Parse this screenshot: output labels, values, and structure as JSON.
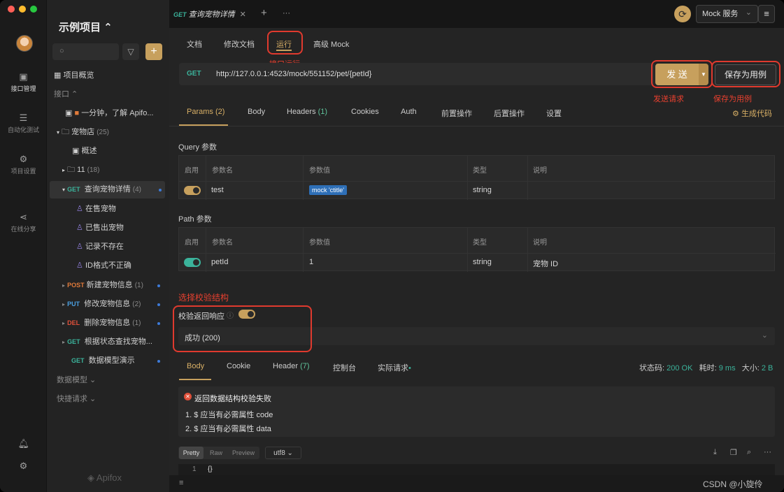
{
  "window": {
    "traffic": [
      "#ff5f57",
      "#febc2e",
      "#28c840"
    ]
  },
  "rail": {
    "items": [
      {
        "label": "接口管理",
        "icon": "api-icon"
      },
      {
        "label": "自动化测试",
        "icon": "test-icon"
      },
      {
        "label": "项目设置",
        "icon": "settings-icon"
      },
      {
        "label": "在线分享",
        "icon": "share-icon"
      }
    ]
  },
  "sidebar": {
    "project": "示例项目 ⌃",
    "overview": "项目概览",
    "api_header": "接口 ⌃",
    "intro": "一分钟，了解 Apifo...",
    "folder": "宠物店",
    "folder_count": "(25)",
    "summary": "概述",
    "sub_folder": "11",
    "sub_folder_count": "(18)",
    "current": {
      "method": "GET",
      "name": "查询宠物详情",
      "count": "(4)"
    },
    "cases": [
      "在售宠物",
      "已售出宠物",
      "记录不存在",
      "ID格式不正确"
    ],
    "apis": [
      {
        "method": "POST",
        "name": "新建宠物信息",
        "count": "(1)"
      },
      {
        "method": "PUT",
        "name": "修改宠物信息",
        "count": "(2)"
      },
      {
        "method": "DEL",
        "name": "删除宠物信息",
        "count": "(1)"
      },
      {
        "method": "GET",
        "name": "根据状态查找宠物...",
        "count": ""
      },
      {
        "method": "GET",
        "name": "数据模型演示",
        "count": ""
      }
    ],
    "data_model": "数据模型 ⌄",
    "quick_request": "快捷请求 ⌄",
    "brand": "Apifox"
  },
  "tabbar": {
    "tab_method": "GET",
    "tab_title": "查询宠物详情",
    "close": "✕",
    "add": "+",
    "more": "···",
    "env": "Mock 服务",
    "env_arrow": "⌄",
    "menu": "≡"
  },
  "subtabs": [
    "文档",
    "修改文档",
    "运行",
    "高级 Mock"
  ],
  "annotation": {
    "run": "接口运行",
    "send": "发送请求",
    "save": "保存为用例",
    "validate": "选择校验结构"
  },
  "request": {
    "method": "GET",
    "url": "http://127.0.0.1:4523/mock/551152/pet/{petId}",
    "send": "发 送",
    "save": "保存为用例"
  },
  "param_tabs": [
    {
      "label": "Params",
      "count": "(2)"
    },
    {
      "label": "Body",
      "count": ""
    },
    {
      "label": "Headers",
      "count": "(1)"
    },
    {
      "label": "Cookies",
      "count": ""
    },
    {
      "label": "Auth",
      "count": ""
    },
    {
      "label": "前置操作",
      "count": ""
    },
    {
      "label": "后置操作",
      "count": ""
    },
    {
      "label": "设置",
      "count": ""
    }
  ],
  "gen_code": "生成代码",
  "query": {
    "title": "Query 参数",
    "headers": [
      "启用",
      "参数名",
      "参数值",
      "类型",
      "说明"
    ],
    "row": {
      "name": "test",
      "value": "mock 'ctitle'",
      "type": "string",
      "desc": ""
    }
  },
  "path": {
    "title": "Path 参数",
    "headers": [
      "启用",
      "参数名",
      "参数值",
      "类型",
      "说明"
    ],
    "row": {
      "name": "petId",
      "value": "1",
      "type": "string",
      "desc": "宠物 ID"
    }
  },
  "validate": {
    "label": "校验返回响应",
    "response": "成功 (200)"
  },
  "response_tabs": [
    {
      "label": "Body",
      "count": ""
    },
    {
      "label": "Cookie",
      "count": ""
    },
    {
      "label": "Header",
      "count": "(7)"
    },
    {
      "label": "控制台",
      "count": ""
    },
    {
      "label": "实际请求",
      "count": ""
    }
  ],
  "response_meta": {
    "status_label": "状态码:",
    "status": "200 OK",
    "time_label": "耗时:",
    "time": "9 ms",
    "size_label": "大小:",
    "size": "2 B"
  },
  "errors": {
    "title": "返回数据结构校验失败",
    "items": [
      "1. $ 应当有必需属性 code",
      "2. $ 应当有必需属性 data"
    ]
  },
  "viewer": {
    "modes": [
      "Pretty",
      "Raw",
      "Preview"
    ],
    "encoding": "utf8 ⌄",
    "line_no": "1",
    "code": "{}"
  },
  "watermark": "CSDN @小旋伶",
  "colors": {
    "accent": "#c7a05d",
    "annotation": "#e03a2e",
    "get": "#3bb39b"
  }
}
